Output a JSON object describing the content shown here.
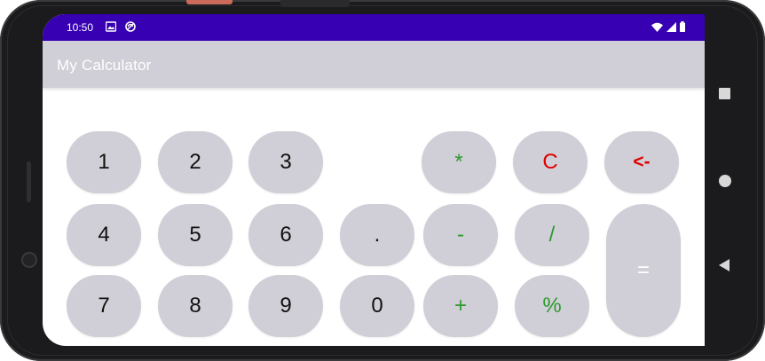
{
  "status_bar": {
    "time": "10:50",
    "left_icons": [
      "image-icon",
      "vpn-icon"
    ],
    "right_icons": [
      "wifi-icon",
      "signal-icon",
      "battery-icon"
    ],
    "bg_color": "#3700b3"
  },
  "app_bar": {
    "title": "My Calculator",
    "bg_color": "#d0ced6"
  },
  "keypad": {
    "k1": "1",
    "k2": "2",
    "k3": "3",
    "k4": "4",
    "k5": "5",
    "k6": "6",
    "k7": "7",
    "k8": "8",
    "k9": "9",
    "k0": "0",
    "dot": ".",
    "multiply": "*",
    "minus": "-",
    "plus": "+",
    "clear": "C",
    "divide": "/",
    "percent": "%",
    "backspace": "<-",
    "equals": "="
  },
  "colors": {
    "key_bg": "#d0ced6",
    "operator": "#2e9a2e",
    "clear": "#e00000",
    "number": "#111111"
  },
  "nav_bar": {
    "icons": [
      "recents-square-icon",
      "home-circle-icon",
      "back-triangle-icon"
    ]
  }
}
